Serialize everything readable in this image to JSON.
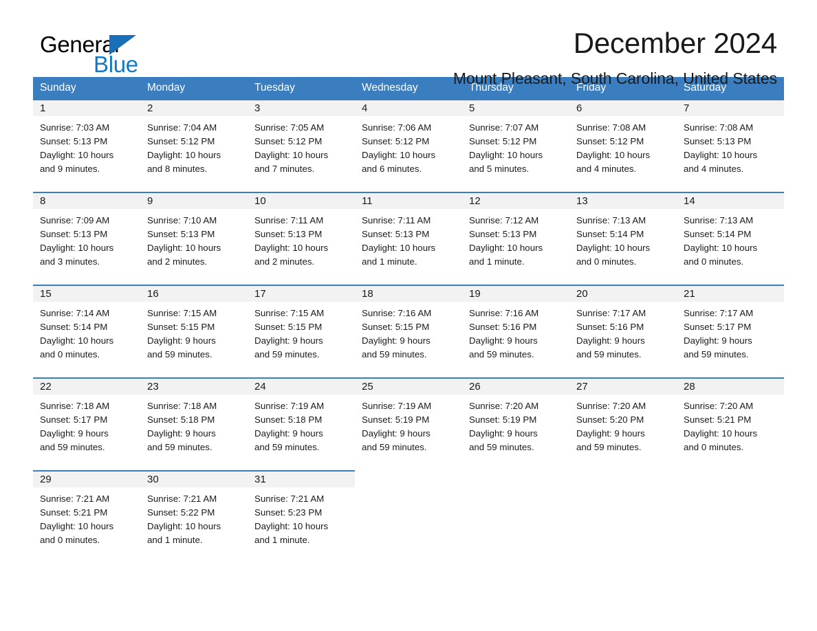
{
  "brand": {
    "name_part1": "General",
    "name_part2": "Blue",
    "triangle_icon": "triangle-icon",
    "accent_color": "#1279c4",
    "header_color": "#3a7ebf"
  },
  "header": {
    "title": "December 2024",
    "subtitle": "Mount Pleasant, South Carolina, United States"
  },
  "calendar": {
    "weekday_headers": [
      "Sunday",
      "Monday",
      "Tuesday",
      "Wednesday",
      "Thursday",
      "Friday",
      "Saturday"
    ],
    "labels": {
      "sunrise_prefix": "Sunrise:",
      "sunset_prefix": "Sunset:",
      "daylight_prefix": "Daylight:"
    },
    "weeks": [
      [
        {
          "day": "1",
          "sunrise": "Sunrise: 7:03 AM",
          "sunset": "Sunset: 5:13 PM",
          "daylight_line1": "Daylight: 10 hours",
          "daylight_line2": "and 9 minutes."
        },
        {
          "day": "2",
          "sunrise": "Sunrise: 7:04 AM",
          "sunset": "Sunset: 5:12 PM",
          "daylight_line1": "Daylight: 10 hours",
          "daylight_line2": "and 8 minutes."
        },
        {
          "day": "3",
          "sunrise": "Sunrise: 7:05 AM",
          "sunset": "Sunset: 5:12 PM",
          "daylight_line1": "Daylight: 10 hours",
          "daylight_line2": "and 7 minutes."
        },
        {
          "day": "4",
          "sunrise": "Sunrise: 7:06 AM",
          "sunset": "Sunset: 5:12 PM",
          "daylight_line1": "Daylight: 10 hours",
          "daylight_line2": "and 6 minutes."
        },
        {
          "day": "5",
          "sunrise": "Sunrise: 7:07 AM",
          "sunset": "Sunset: 5:12 PM",
          "daylight_line1": "Daylight: 10 hours",
          "daylight_line2": "and 5 minutes."
        },
        {
          "day": "6",
          "sunrise": "Sunrise: 7:08 AM",
          "sunset": "Sunset: 5:12 PM",
          "daylight_line1": "Daylight: 10 hours",
          "daylight_line2": "and 4 minutes."
        },
        {
          "day": "7",
          "sunrise": "Sunrise: 7:08 AM",
          "sunset": "Sunset: 5:13 PM",
          "daylight_line1": "Daylight: 10 hours",
          "daylight_line2": "and 4 minutes."
        }
      ],
      [
        {
          "day": "8",
          "sunrise": "Sunrise: 7:09 AM",
          "sunset": "Sunset: 5:13 PM",
          "daylight_line1": "Daylight: 10 hours",
          "daylight_line2": "and 3 minutes."
        },
        {
          "day": "9",
          "sunrise": "Sunrise: 7:10 AM",
          "sunset": "Sunset: 5:13 PM",
          "daylight_line1": "Daylight: 10 hours",
          "daylight_line2": "and 2 minutes."
        },
        {
          "day": "10",
          "sunrise": "Sunrise: 7:11 AM",
          "sunset": "Sunset: 5:13 PM",
          "daylight_line1": "Daylight: 10 hours",
          "daylight_line2": "and 2 minutes."
        },
        {
          "day": "11",
          "sunrise": "Sunrise: 7:11 AM",
          "sunset": "Sunset: 5:13 PM",
          "daylight_line1": "Daylight: 10 hours",
          "daylight_line2": "and 1 minute."
        },
        {
          "day": "12",
          "sunrise": "Sunrise: 7:12 AM",
          "sunset": "Sunset: 5:13 PM",
          "daylight_line1": "Daylight: 10 hours",
          "daylight_line2": "and 1 minute."
        },
        {
          "day": "13",
          "sunrise": "Sunrise: 7:13 AM",
          "sunset": "Sunset: 5:14 PM",
          "daylight_line1": "Daylight: 10 hours",
          "daylight_line2": "and 0 minutes."
        },
        {
          "day": "14",
          "sunrise": "Sunrise: 7:13 AM",
          "sunset": "Sunset: 5:14 PM",
          "daylight_line1": "Daylight: 10 hours",
          "daylight_line2": "and 0 minutes."
        }
      ],
      [
        {
          "day": "15",
          "sunrise": "Sunrise: 7:14 AM",
          "sunset": "Sunset: 5:14 PM",
          "daylight_line1": "Daylight: 10 hours",
          "daylight_line2": "and 0 minutes."
        },
        {
          "day": "16",
          "sunrise": "Sunrise: 7:15 AM",
          "sunset": "Sunset: 5:15 PM",
          "daylight_line1": "Daylight: 9 hours",
          "daylight_line2": "and 59 minutes."
        },
        {
          "day": "17",
          "sunrise": "Sunrise: 7:15 AM",
          "sunset": "Sunset: 5:15 PM",
          "daylight_line1": "Daylight: 9 hours",
          "daylight_line2": "and 59 minutes."
        },
        {
          "day": "18",
          "sunrise": "Sunrise: 7:16 AM",
          "sunset": "Sunset: 5:15 PM",
          "daylight_line1": "Daylight: 9 hours",
          "daylight_line2": "and 59 minutes."
        },
        {
          "day": "19",
          "sunrise": "Sunrise: 7:16 AM",
          "sunset": "Sunset: 5:16 PM",
          "daylight_line1": "Daylight: 9 hours",
          "daylight_line2": "and 59 minutes."
        },
        {
          "day": "20",
          "sunrise": "Sunrise: 7:17 AM",
          "sunset": "Sunset: 5:16 PM",
          "daylight_line1": "Daylight: 9 hours",
          "daylight_line2": "and 59 minutes."
        },
        {
          "day": "21",
          "sunrise": "Sunrise: 7:17 AM",
          "sunset": "Sunset: 5:17 PM",
          "daylight_line1": "Daylight: 9 hours",
          "daylight_line2": "and 59 minutes."
        }
      ],
      [
        {
          "day": "22",
          "sunrise": "Sunrise: 7:18 AM",
          "sunset": "Sunset: 5:17 PM",
          "daylight_line1": "Daylight: 9 hours",
          "daylight_line2": "and 59 minutes."
        },
        {
          "day": "23",
          "sunrise": "Sunrise: 7:18 AM",
          "sunset": "Sunset: 5:18 PM",
          "daylight_line1": "Daylight: 9 hours",
          "daylight_line2": "and 59 minutes."
        },
        {
          "day": "24",
          "sunrise": "Sunrise: 7:19 AM",
          "sunset": "Sunset: 5:18 PM",
          "daylight_line1": "Daylight: 9 hours",
          "daylight_line2": "and 59 minutes."
        },
        {
          "day": "25",
          "sunrise": "Sunrise: 7:19 AM",
          "sunset": "Sunset: 5:19 PM",
          "daylight_line1": "Daylight: 9 hours",
          "daylight_line2": "and 59 minutes."
        },
        {
          "day": "26",
          "sunrise": "Sunrise: 7:20 AM",
          "sunset": "Sunset: 5:19 PM",
          "daylight_line1": "Daylight: 9 hours",
          "daylight_line2": "and 59 minutes."
        },
        {
          "day": "27",
          "sunrise": "Sunrise: 7:20 AM",
          "sunset": "Sunset: 5:20 PM",
          "daylight_line1": "Daylight: 9 hours",
          "daylight_line2": "and 59 minutes."
        },
        {
          "day": "28",
          "sunrise": "Sunrise: 7:20 AM",
          "sunset": "Sunset: 5:21 PM",
          "daylight_line1": "Daylight: 10 hours",
          "daylight_line2": "and 0 minutes."
        }
      ],
      [
        {
          "day": "29",
          "sunrise": "Sunrise: 7:21 AM",
          "sunset": "Sunset: 5:21 PM",
          "daylight_line1": "Daylight: 10 hours",
          "daylight_line2": "and 0 minutes."
        },
        {
          "day": "30",
          "sunrise": "Sunrise: 7:21 AM",
          "sunset": "Sunset: 5:22 PM",
          "daylight_line1": "Daylight: 10 hours",
          "daylight_line2": "and 1 minute."
        },
        {
          "day": "31",
          "sunrise": "Sunrise: 7:21 AM",
          "sunset": "Sunset: 5:23 PM",
          "daylight_line1": "Daylight: 10 hours",
          "daylight_line2": "and 1 minute."
        },
        {
          "day": "",
          "sunrise": "",
          "sunset": "",
          "daylight_line1": "",
          "daylight_line2": ""
        },
        {
          "day": "",
          "sunrise": "",
          "sunset": "",
          "daylight_line1": "",
          "daylight_line2": ""
        },
        {
          "day": "",
          "sunrise": "",
          "sunset": "",
          "daylight_line1": "",
          "daylight_line2": ""
        },
        {
          "day": "",
          "sunrise": "",
          "sunset": "",
          "daylight_line1": "",
          "daylight_line2": ""
        }
      ]
    ]
  }
}
